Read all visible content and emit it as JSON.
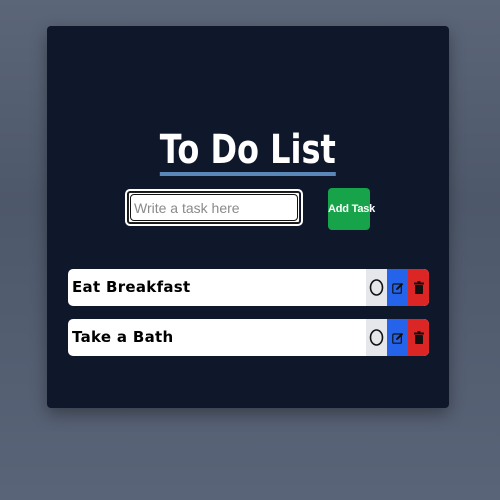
{
  "app": {
    "title": "To Do List"
  },
  "form": {
    "input_placeholder": "Write a task here",
    "input_value": "",
    "add_button_label": "Add Task"
  },
  "tasks": [
    {
      "label": "Eat Breakfast",
      "completed": false
    },
    {
      "label": "Take a Bath",
      "completed": false
    }
  ],
  "icons": {
    "complete": "circle-icon",
    "edit": "edit-icon",
    "delete": "trash-icon"
  },
  "colors": {
    "page_background": "#545e70",
    "card_background": "#0f172a",
    "title_underline": "#5a86b8",
    "add_button": "#16a34a",
    "complete_button": "#e5e7eb",
    "edit_button": "#2563eb",
    "delete_button": "#dc2626"
  }
}
